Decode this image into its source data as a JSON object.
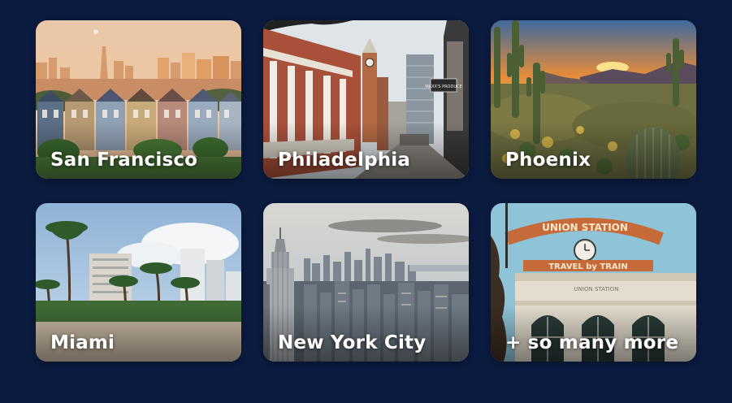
{
  "colors": {
    "page_background": "#0b1a3f",
    "label_text": "#ffffff"
  },
  "cities": [
    {
      "name": "San Francisco",
      "scene": "painted-ladies-skyline"
    },
    {
      "name": "Philadelphia",
      "scene": "historic-street-clock-tower"
    },
    {
      "name": "Phoenix",
      "scene": "desert-saguaro-sunset"
    },
    {
      "name": "Miami",
      "scene": "palm-beach-highrises"
    },
    {
      "name": "New York City",
      "scene": "empire-state-skyline"
    },
    {
      "name": "+ so many more",
      "scene": "union-station-travel-by-train"
    }
  ],
  "signs": {
    "produce_sign": "MAXX'S PRODUCE",
    "union_station_top": "UNION STATION",
    "union_station_bottom": "TRAVEL by TRAIN",
    "union_station_facade": "UNION STATION"
  }
}
